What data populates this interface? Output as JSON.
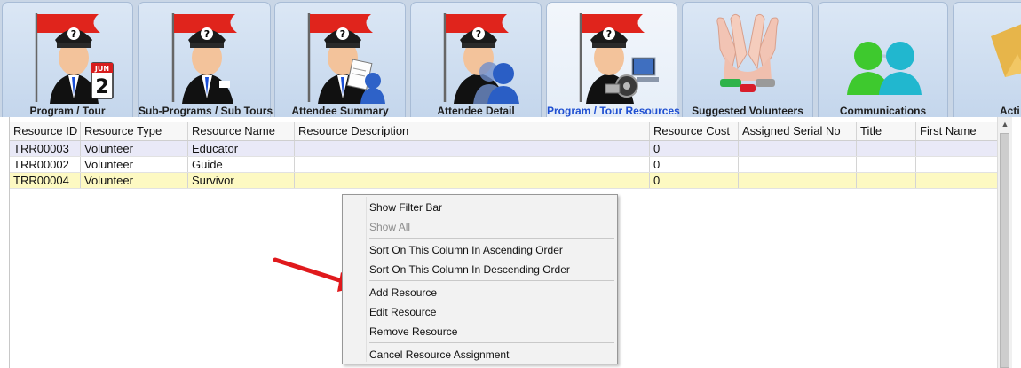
{
  "tabs": [
    {
      "label": "Program / Tour",
      "icon": "program-tour-icon",
      "active": false
    },
    {
      "label": "Sub-Programs / Sub Tours",
      "icon": "sub-programs-icon",
      "active": false
    },
    {
      "label": "Attendee Summary",
      "icon": "attendee-summary-icon",
      "active": false
    },
    {
      "label": "Attendee Detail",
      "icon": "attendee-detail-icon",
      "active": false
    },
    {
      "label": "Program / Tour Resources",
      "icon": "resources-icon",
      "active": true
    },
    {
      "label": "Suggested Volunteers",
      "icon": "volunteers-hands-icon",
      "active": false
    },
    {
      "label": "Communications",
      "icon": "communications-icon",
      "active": false
    },
    {
      "label": "Acti",
      "icon": "actions-icon",
      "active": false
    }
  ],
  "calendar": {
    "month": "JUN",
    "day": "2"
  },
  "grid": {
    "columns": [
      "Resource ID",
      "Resource Type",
      "Resource Name",
      "Resource Description",
      "Resource Cost",
      "Assigned Serial No",
      "Title",
      "First Name"
    ],
    "rows": [
      [
        "TRR00003",
        "Volunteer",
        "Educator",
        "",
        "0",
        "",
        "",
        ""
      ],
      [
        "TRR00002",
        "Volunteer",
        "Guide",
        "",
        "0",
        "",
        "",
        ""
      ],
      [
        "TRR00004",
        "Volunteer",
        "Survivor",
        "",
        "0",
        "",
        "",
        ""
      ]
    ]
  },
  "context_menu": {
    "items": [
      {
        "label": "Show Filter Bar",
        "enabled": true
      },
      {
        "label": "Show All",
        "enabled": false
      },
      {
        "label": "Sort On This Column In Ascending Order",
        "enabled": true
      },
      {
        "label": "Sort On This Column In Descending Order",
        "enabled": true
      },
      {
        "label": "Add Resource",
        "enabled": true
      },
      {
        "label": "Edit Resource",
        "enabled": true
      },
      {
        "label": "Remove Resource",
        "enabled": true
      },
      {
        "label": "Cancel Resource Assignment",
        "enabled": true
      }
    ]
  },
  "colors": {
    "active_tab_text": "#1f4fd1",
    "row_selected": "#fdf9c2",
    "row_alt": "#e9e9f7",
    "arrow": "#e0191c",
    "flag": "#e0241c"
  }
}
